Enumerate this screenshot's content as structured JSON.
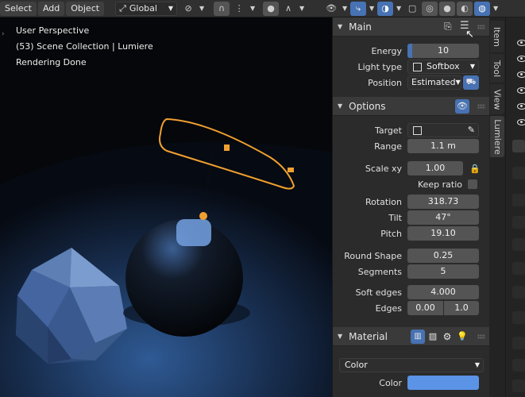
{
  "header": {
    "menu": [
      "Select",
      "Add",
      "Object"
    ],
    "orientation": "Global"
  },
  "viewport": {
    "overlay_lines": [
      "User Perspective",
      "(53) Scene Collection | Lumiere",
      "Rendering Done"
    ]
  },
  "panel": {
    "main": {
      "title": "Main",
      "energy_label": "Energy",
      "energy_value": "10",
      "light_type_label": "Light type",
      "light_type_value": "Softbox",
      "position_label": "Position",
      "position_value": "Estimated"
    },
    "options": {
      "title": "Options",
      "target_label": "Target",
      "range_label": "Range",
      "range_value": "1.1 m",
      "scale_label": "Scale xy",
      "scale_value": "1.00",
      "keep_ratio_label": "Keep ratio",
      "rotation_label": "Rotation",
      "rotation_value": "318.73",
      "tilt_label": "Tilt",
      "tilt_value": "47°",
      "pitch_label": "Pitch",
      "pitch_value": "19.10",
      "round_shape_label": "Round Shape",
      "round_shape_value": "0.25",
      "segments_label": "Segments",
      "segments_value": "5",
      "soft_edges_label": "Soft edges",
      "soft_edges_value": "4.000",
      "edges_label": "Edges",
      "edges_value_1": "0.00",
      "edges_value_2": "1.0"
    },
    "material": {
      "title": "Material",
      "mode_value": "Color",
      "color_label": "Color",
      "color_hex": "#5b93e6"
    }
  },
  "tabs": [
    "Item",
    "Tool",
    "View",
    "Lumiere"
  ],
  "colors": {
    "accent": "#4772b3",
    "light_outline": "#f0a030"
  }
}
